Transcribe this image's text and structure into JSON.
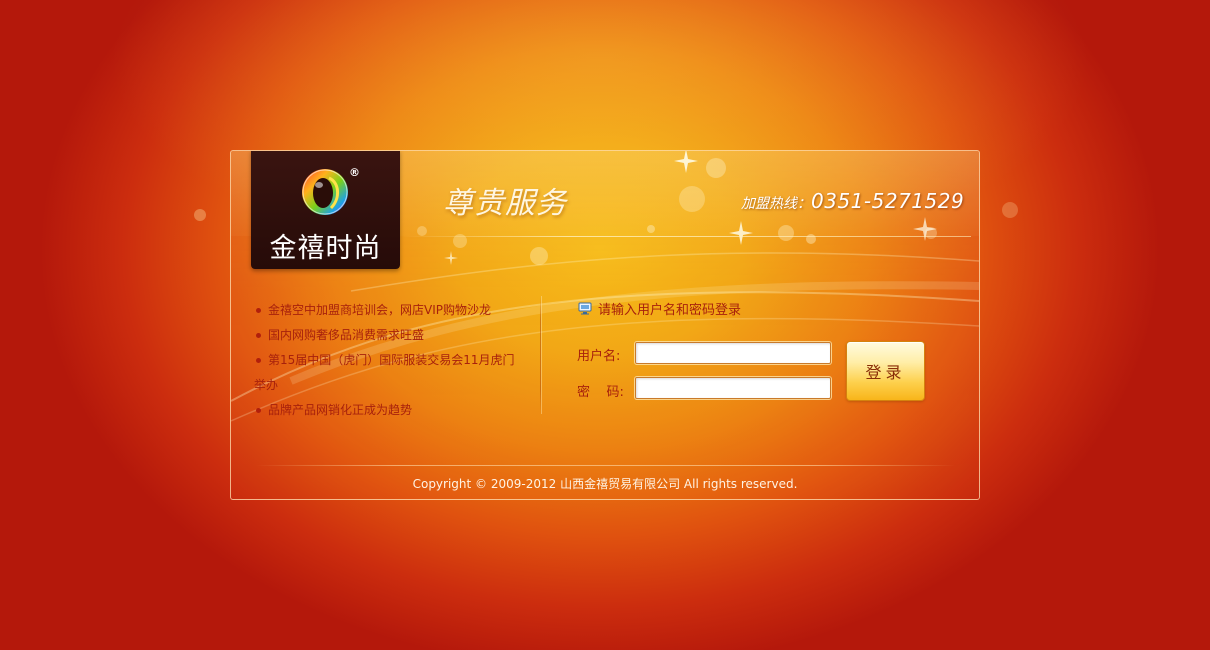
{
  "brand": {
    "logo_text": "金禧时尚",
    "registered_mark": "®"
  },
  "header": {
    "service_title": "尊贵服务",
    "hotline_label": "加盟热线：",
    "hotline_number": "0351-5271529"
  },
  "news": {
    "items": [
      "金禧空中加盟商培训会，网店VIP购物沙龙",
      "国内网购奢侈品消费需求旺盛",
      "第15届中国（虎门）国际服装交易会11月虎门",
      "品牌产品网销化正成为趋势"
    ],
    "item3_continuation": "举办"
  },
  "login": {
    "prompt": "请输入用户名和密码登录",
    "username_label": "用户名:",
    "username_value": "",
    "password_label": "密    码:",
    "password_value": "",
    "submit_label": "登录"
  },
  "footer": {
    "copyright": "Copyright © 2009-2012 山西金禧贸易有限公司 All rights reserved."
  },
  "colors": {
    "background_center": "#f7bb17",
    "background_edge": "#b4180b",
    "text_red": "#a8210c",
    "logo_bg": "#260b08",
    "button_gold": "#fdd04c"
  }
}
